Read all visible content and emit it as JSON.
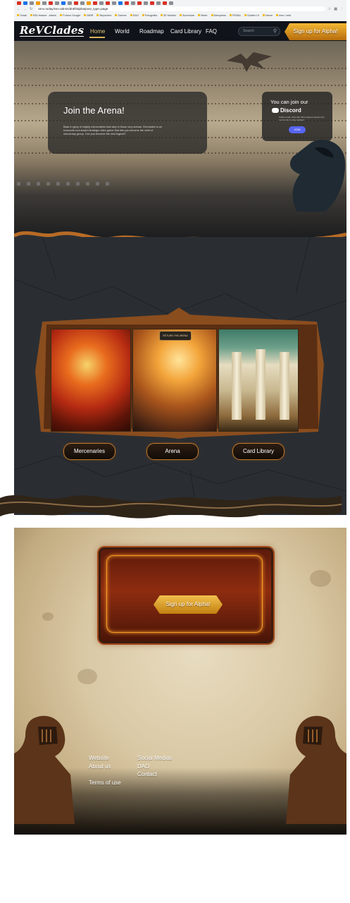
{
  "browser": {
    "url": "arno.today/sso-admin/draft/alpha/post_type=page",
    "bookmarks": [
      "Gmail",
      "RDI feature - Admin",
      "Formul Google",
      "MMR",
      "Beyondex",
      "Games",
      "DAO",
      "Fotografia",
      "3D Models",
      "Accenture",
      "Mesh",
      "Aliexpress",
      "FIDMA",
      "Golden UI",
      "Nerve",
      "new / web"
    ]
  },
  "nav": {
    "logo": "ReVClades",
    "items": [
      "Home",
      "World",
      "Roadmap",
      "Card Library",
      "FAQ"
    ],
    "search_placeholder": "Search",
    "signup": "Sign up for Alpha!"
  },
  "hero": {
    "title": "Join the Arena!",
    "text": "Bask in glory of mighty mercenaries that step in those very arenas. Revclades is an economic turn-based strategic video game that lets you become the chief of mercenary group. Can you become the next legend?",
    "discord": {
      "line1": "You can join our",
      "brand": "Discord",
      "text": "Follow news, chat with other players and join the community to stay updated",
      "join": "JOIN"
    }
  },
  "cards": {
    "badge": "RETURN THE ARENA",
    "buttons": [
      "Mercenaries",
      "Arena",
      "Card Library"
    ]
  },
  "cta": {
    "button": "Sign up for Alpha!"
  },
  "footer": {
    "col1": [
      "Website",
      "About us",
      "Terms of use"
    ],
    "col2": [
      "Social Medias",
      "DAO",
      "Contact"
    ]
  },
  "colors": {
    "accent_gold": "#e3c57a",
    "discord_blue": "#5865f2",
    "cta_orange": "#f19b2a"
  }
}
